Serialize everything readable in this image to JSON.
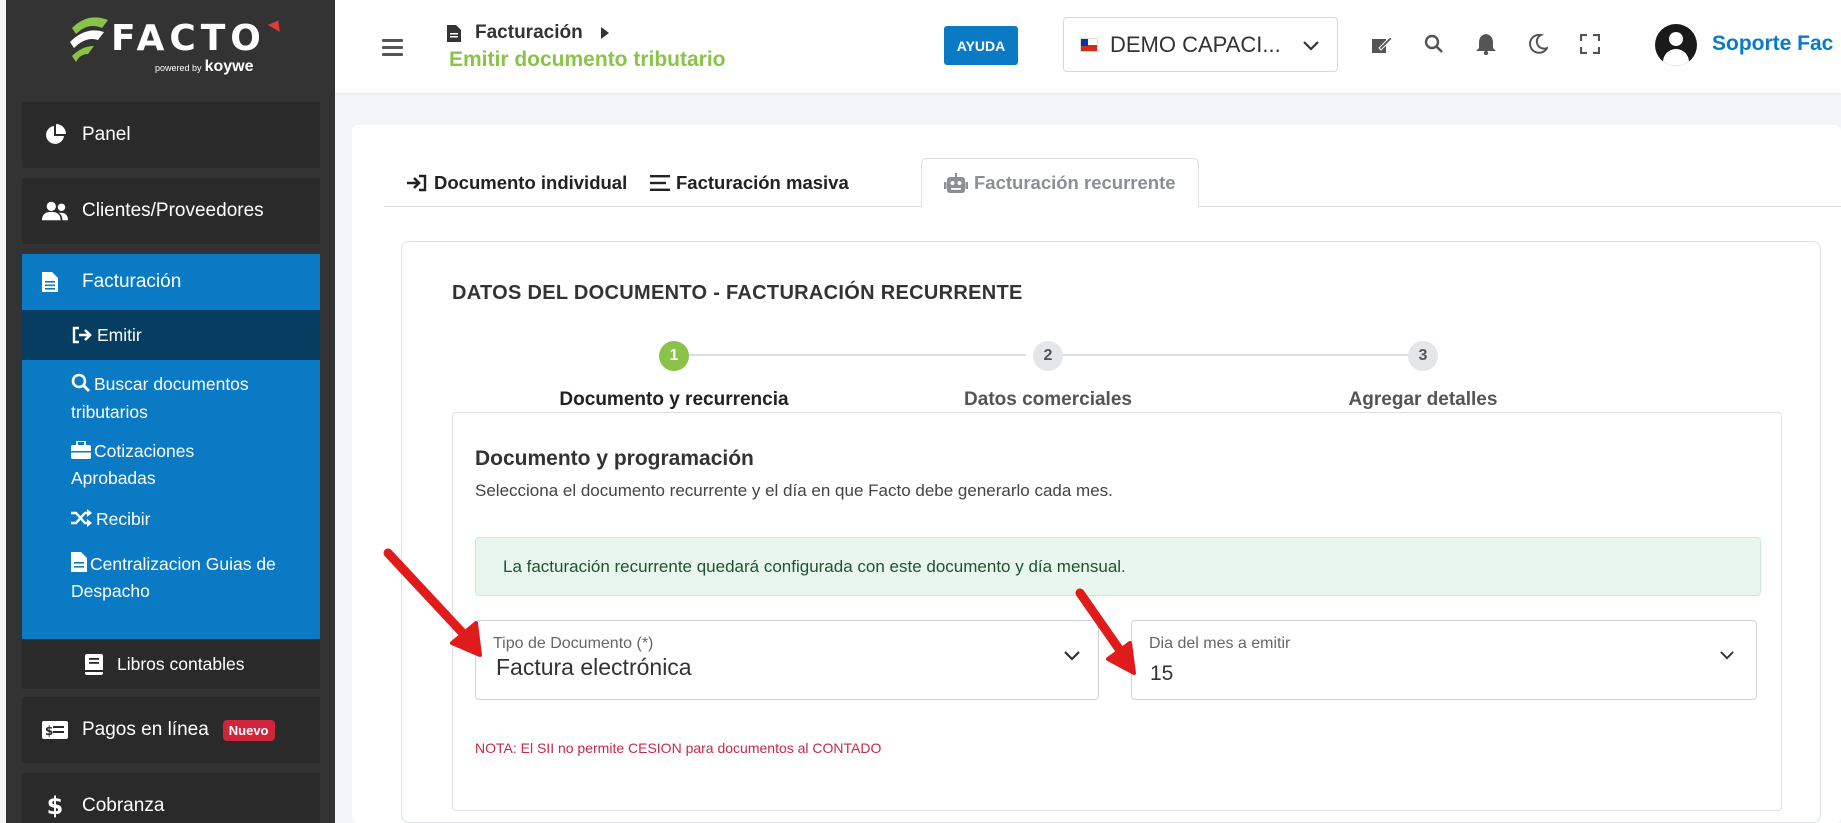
{
  "sidebar": {
    "logo_text": "FACTO",
    "logo_sub_powered": "powered by",
    "logo_sub_brand": "koywe",
    "items": [
      {
        "label": "Panel",
        "icon": "pie-chart-icon"
      },
      {
        "label": "Clientes/Proveedores",
        "icon": "users-icon"
      },
      {
        "label": "Facturación",
        "icon": "file-icon"
      },
      {
        "label": "Pagos en línea",
        "icon": "money-bill-icon",
        "badge": "Nuevo"
      },
      {
        "label": "Cobranza",
        "icon": "dollar-icon"
      }
    ],
    "facturacion_sub": [
      {
        "label": "Emitir",
        "icon": "sign-out-icon"
      },
      {
        "label": "Buscar documentos tributarios",
        "icon": "search-icon"
      },
      {
        "label": "Cotizaciones Aprobadas",
        "icon": "briefcase-icon"
      },
      {
        "label": "Recibir",
        "icon": "shuffle-icon"
      },
      {
        "label": "Centralizacion Guias de Despacho",
        "icon": "file-icon"
      }
    ],
    "libros": {
      "label": "Libros contables",
      "icon": "book-icon"
    }
  },
  "header": {
    "breadcrumb": "Facturación",
    "page_title": "Emitir documento tributario",
    "help_label": "AYUDA",
    "company": "DEMO CAPACI...",
    "user_name": "Soporte Fac"
  },
  "tabs": [
    {
      "label": "Documento individual",
      "icon": "sign-in-icon"
    },
    {
      "label": "Facturación masiva",
      "icon": "list-icon"
    },
    {
      "label": "Facturación recurrente",
      "icon": "robot-icon"
    }
  ],
  "main": {
    "title": "DATOS DEL DOCUMENTO - FACTURACIÓN RECURRENTE",
    "steps": [
      {
        "number": "1",
        "label": "Documento y recurrencia"
      },
      {
        "number": "2",
        "label": "Datos comerciales"
      },
      {
        "number": "3",
        "label": "Agregar detalles"
      }
    ],
    "section_title": "Documento y programación",
    "section_desc": "Selecciona el documento recurrente y el día en que Facto debe generarlo cada mes.",
    "alert": "La facturación recurrente quedará configurada con este documento y día mensual.",
    "doc_type": {
      "label": "Tipo de Documento (*)",
      "value": "Factura electrónica"
    },
    "day": {
      "label": "Dia del mes a emitir",
      "value": "15"
    },
    "note": "NOTA: El SII no permite CESION para documentos al CONTADO"
  },
  "colors": {
    "primary": "#0a7ac4",
    "accent": "#8bc34a",
    "sidebar": "#333333",
    "arrow": "#e01b1b"
  }
}
